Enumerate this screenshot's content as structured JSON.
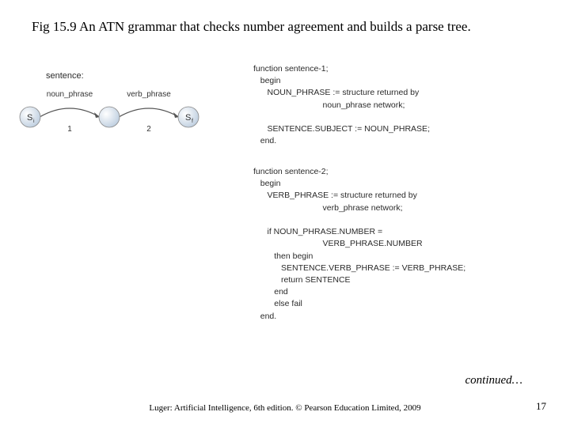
{
  "title": "Fig 15.9  An ATN grammar that checks number agreement and builds a parse tree.",
  "diagram": {
    "label": "sentence:",
    "nodes": [
      "S",
      "",
      "S"
    ],
    "node_sub": [
      "i",
      "",
      "f"
    ],
    "edges": [
      "noun_phrase",
      "verb_phrase"
    ],
    "edge_nums": [
      "1",
      "2"
    ]
  },
  "code1": "function sentence-1;\n   begin\n      NOUN_PHRASE := structure returned by\n                              noun_phrase network;\n\n      SENTENCE.SUBJECT := NOUN_PHRASE;\n   end.",
  "code2": "function sentence-2;\n   begin\n      VERB_PHRASE := structure returned by\n                              verb_phrase network;\n\n      if NOUN_PHRASE.NUMBER =\n                              VERB_PHRASE.NUMBER\n         then begin\n            SENTENCE.VERB_PHRASE := VERB_PHRASE;\n            return SENTENCE\n         end\n         else fail\n   end.",
  "continued": "continued…",
  "footer": "Luger: Artificial Intelligence, 6th edition. © Pearson Education Limited, 2009",
  "page_num": "17"
}
